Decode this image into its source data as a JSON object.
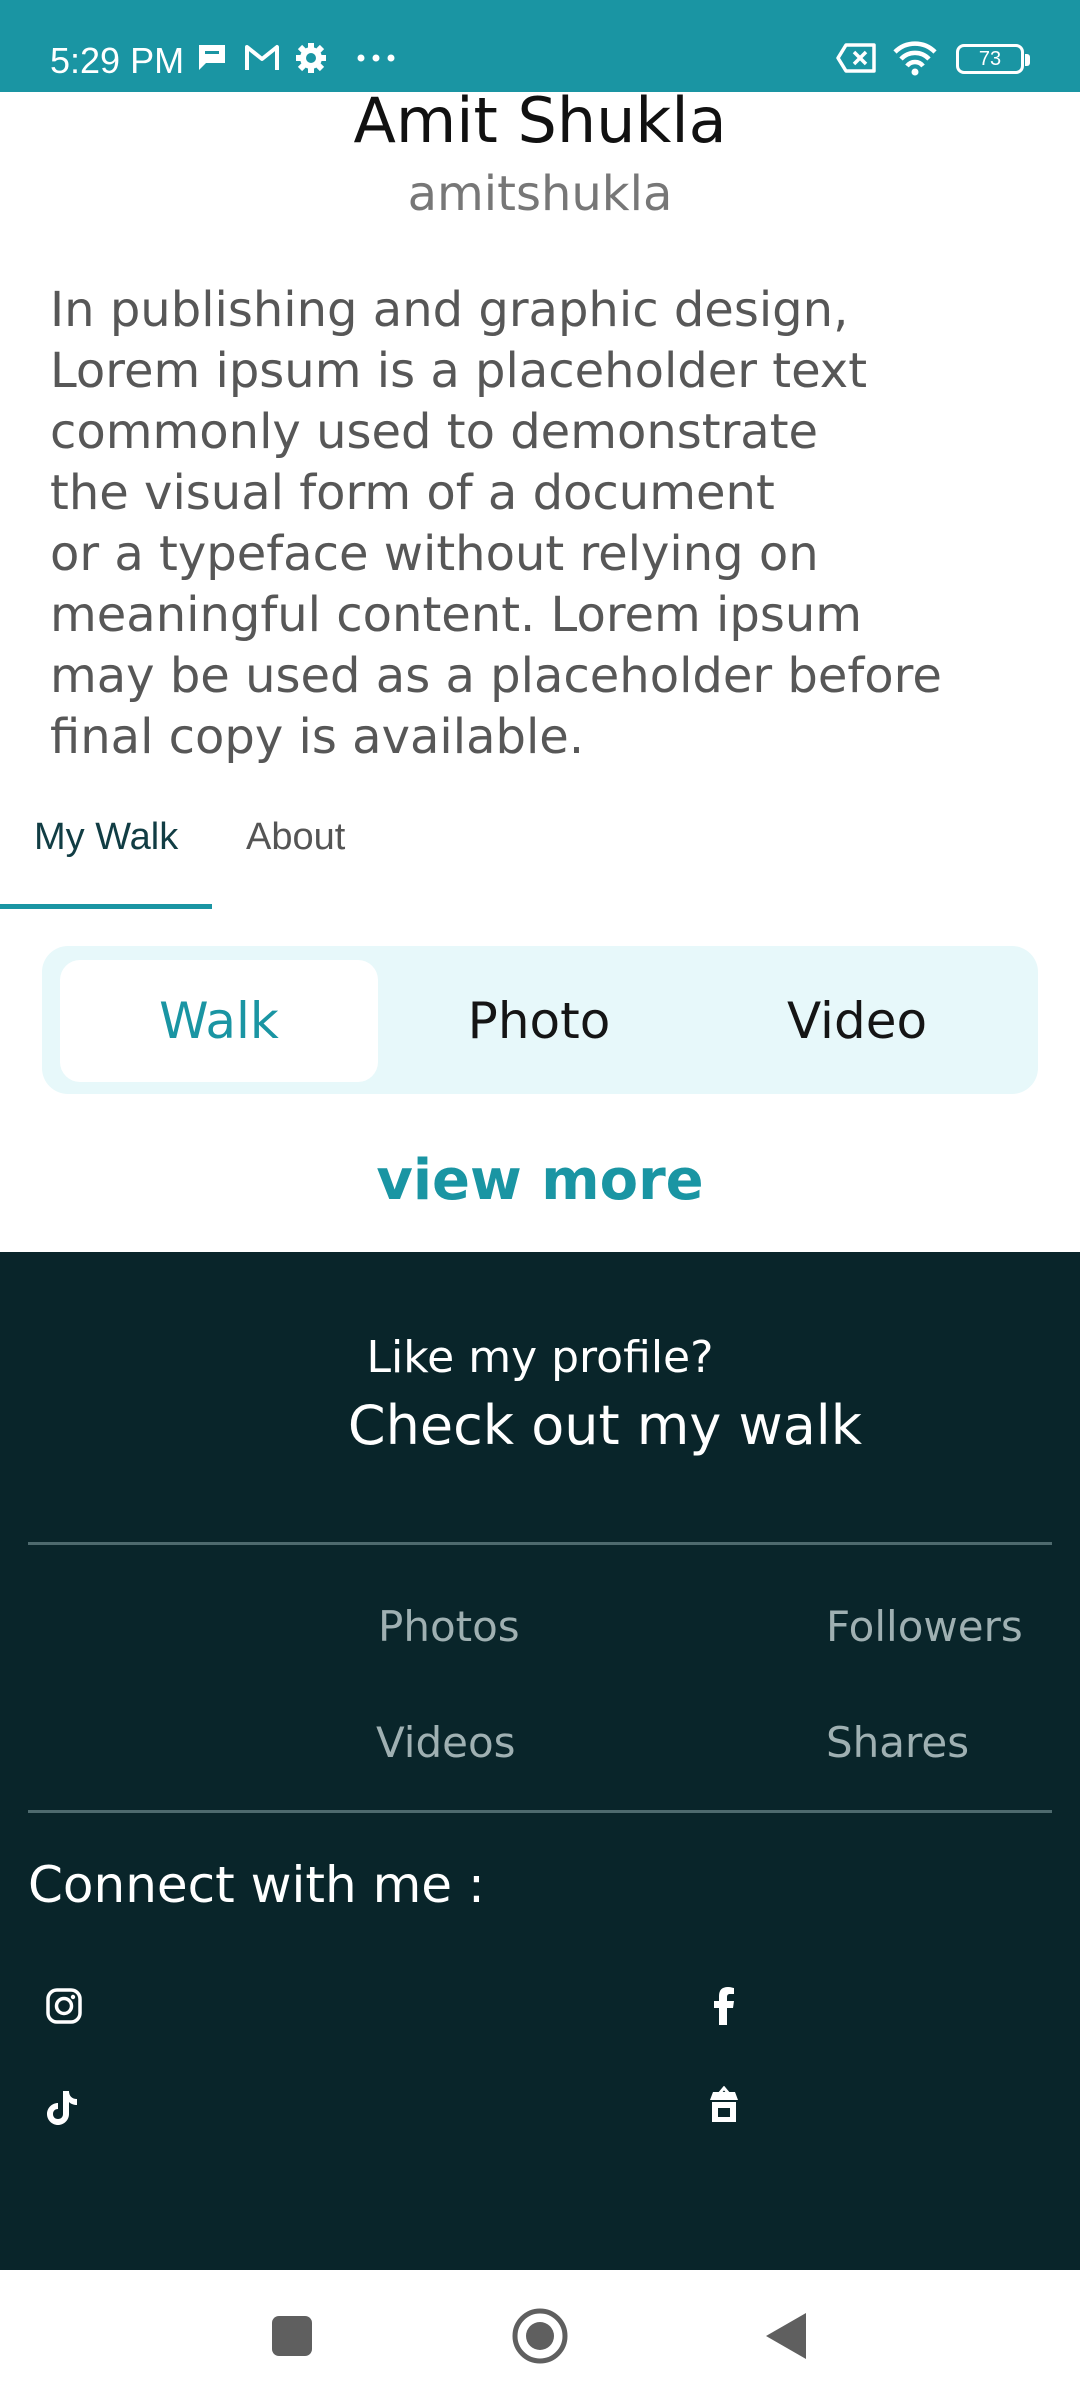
{
  "status_bar": {
    "time": "5:29 PM",
    "battery": "73",
    "icons": [
      "message-icon",
      "gmail-icon",
      "settings-icon",
      "more-dots-icon",
      "sim-off-icon",
      "wifi-icon",
      "battery-icon"
    ]
  },
  "profile": {
    "name": "Amit Shukla",
    "handle": "amitshukla",
    "bio": "In publishing and graphic design,\nLorem ipsum is a placeholder text\ncommonly used to demonstrate\nthe visual form of a document\nor a typeface without relying on\nmeaningful content. Lorem ipsum\nmay be used as a placeholder before\nfinal copy is available."
  },
  "tabs": {
    "items": [
      "My Walk",
      "About"
    ],
    "active": "My Walk"
  },
  "segment": {
    "options": [
      "Walk",
      "Photo",
      "Video"
    ],
    "selected": "Walk"
  },
  "view_more": "view more",
  "footer": {
    "cta_line1": "Like my profile?",
    "cta_line2": "Check out my walk",
    "stats": [
      "Photos",
      "Followers",
      "Videos",
      "Shares"
    ],
    "connect_label": "Connect with me :",
    "socials": [
      "instagram-icon",
      "facebook-icon",
      "tiktok-icon",
      "store-icon"
    ]
  },
  "colors": {
    "accent": "#1a95a3",
    "footer_bg": "#09252a",
    "segment_bg": "#e7f8fa"
  }
}
